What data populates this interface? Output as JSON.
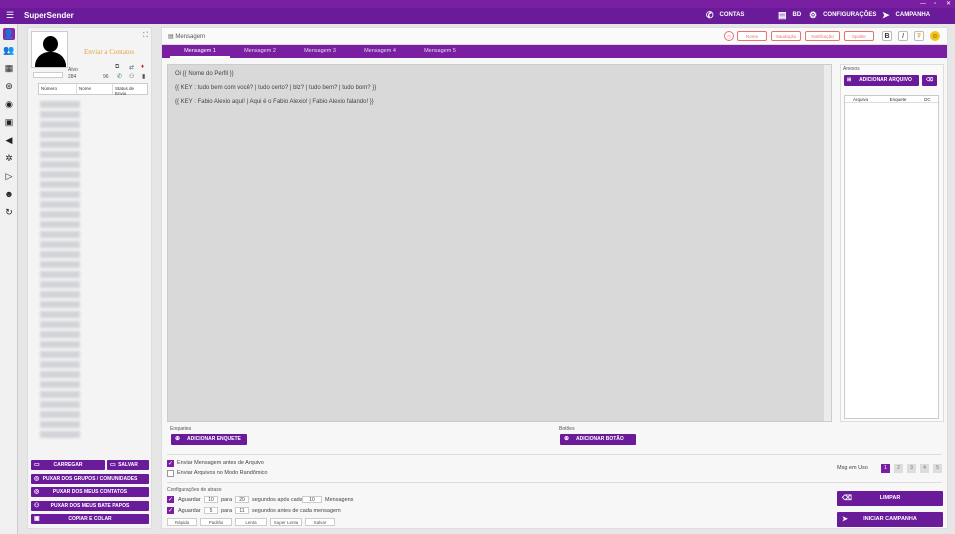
{
  "window": {
    "minimize": "—",
    "maximize": "▫",
    "close": "✕"
  },
  "header": {
    "app_title": "SuperSender",
    "contas": "CONTAS",
    "bd": "BD",
    "configuracoes": "CONFIGURAÇÕES",
    "campanha": "CAMPANHA"
  },
  "sidebar_icons": [
    "user-icon",
    "users-icon",
    "calendar-icon",
    "filter-icon",
    "chat-icon",
    "image-icon",
    "megaphone-icon",
    "network-icon",
    "play-icon",
    "robot-icon",
    "refresh-icon"
  ],
  "contacts_panel": {
    "send_to": "Enviar a Contatos",
    "alvo_label": "Alvo",
    "alvo_value": "284",
    "count_value": "96",
    "columns": [
      "Número",
      "Nome",
      "Status de Envio"
    ],
    "buttons": {
      "carregar": "CARREGAR",
      "salvar": "SALVAR",
      "grupos": "PUXAR DOS GRUPOS / COMUNIDADES",
      "contatos": "PUXAR DOS MEUS CONTATOS",
      "bate_papos": "PUXAR DOS MEUS BATE PAPOS",
      "copiar": "COPIAR E COLAR"
    }
  },
  "message": {
    "label": "Mensagem",
    "pills": [
      "Nome",
      "Saudação",
      "Notificação",
      "Spoiler"
    ],
    "tabs": [
      "Mensagem 1",
      "Mensagem 2",
      "Mensagem 3",
      "Mensagem 4",
      "Mensagem 5"
    ],
    "lines": [
      "Oi {{ Nome do Perfil }}",
      "{{ KEY : tudo bem com você? | tudo certo? | blz? | tudo bem? | tudo bom? }}",
      "{{ KEY : Fabio Alexio aqui! | Aqui é o Fabio Alexio! | Fabio Alexio falando! }}"
    ]
  },
  "attachments": {
    "title": "Anexos",
    "add_button": "ADICIONAR ARQUIVO",
    "columns": [
      "Arquivo",
      "Enquete",
      "DC"
    ]
  },
  "polls": {
    "title": "Enquetes",
    "button": "ADICIONAR ENQUETE"
  },
  "buttons_section": {
    "title": "Botões",
    "button": "ADICIONAR BOTÃO"
  },
  "options": {
    "send_before_files": "Enviar Mensagem antes de Arquivo",
    "send_random_files": "Enviar Arquivos no Modo Randômico",
    "msg_in_use": "Msg em Uso",
    "pages": [
      "1",
      "2",
      "3",
      "4",
      "5"
    ]
  },
  "delay": {
    "title": "Configurações de atraso",
    "aguardar1": "Aguardar",
    "min1": "10",
    "para1": "para",
    "max1": "20",
    "after_each": "segundos após cada",
    "count": "10",
    "mensagens": "Mensagens",
    "aguardar2": "Aguardar",
    "min2": "5",
    "para2": "para",
    "max2": "11",
    "before_each": "segundos antes de cada mensagem",
    "presets": [
      "Rápida",
      "Padrão",
      "Lenta",
      "Super Lenta",
      "Salvar"
    ]
  },
  "actions": {
    "limpar": "LIMPAR",
    "iniciar": "INICIAR CAMPANHA"
  },
  "colors": {
    "accent": "#6a1b9a",
    "titlebar": "#7b1fa2"
  }
}
